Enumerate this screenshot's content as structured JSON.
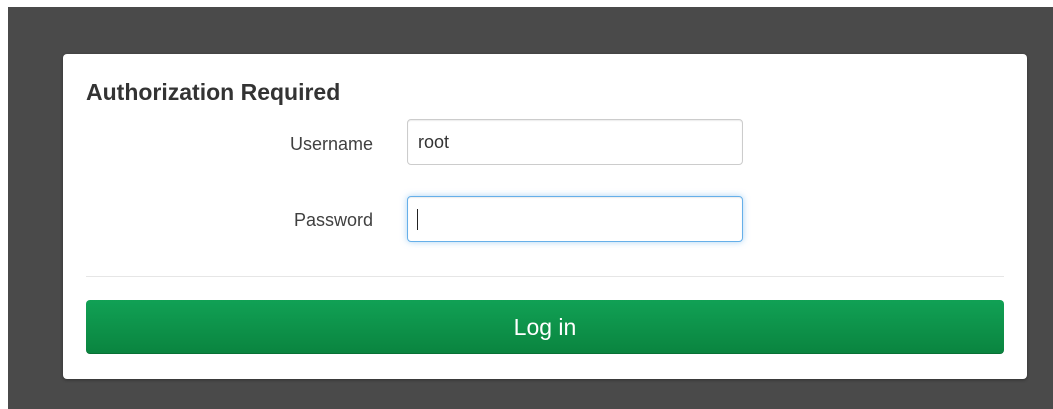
{
  "login_form": {
    "title": "Authorization Required",
    "username_label": "Username",
    "username_value": "root",
    "password_label": "Password",
    "password_value": "",
    "login_button_label": "Log in"
  },
  "colors": {
    "backdrop": "#4a4a4a",
    "panel": "#ffffff",
    "button": "#0a8a44",
    "focus_border": "#66afe9"
  }
}
